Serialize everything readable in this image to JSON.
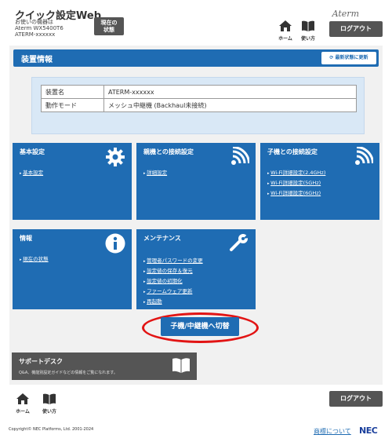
{
  "header": {
    "app_title": "クイック設定Web",
    "device_lines": [
      "お使いの機器は",
      "Aterm WX5400T6",
      "ATERM-xxxxxx"
    ],
    "state_button": "現在の\n状態",
    "logo": "Aterm",
    "home_label": "ホーム",
    "help_label": "使い方",
    "logout_label": "ログアウト"
  },
  "section": {
    "title": "装置情報",
    "refresh_label": "最新状態に更新"
  },
  "device_info": [
    {
      "key": "装置名",
      "value": "ATERM-xxxxxx"
    },
    {
      "key": "動作モード",
      "value": "メッシュ中継機 (Backhaul未接続)"
    }
  ],
  "cards": {
    "basic": {
      "title": "基本設定",
      "icon": "gear-icon",
      "links": [
        "基本設定"
      ]
    },
    "parent": {
      "title": "親機との接続設定",
      "icon": "wifi-icon",
      "links": [
        "詳細設定"
      ]
    },
    "child": {
      "title": "子機との接続設定",
      "icon": "wifi-icon",
      "links": [
        "Wi-Fi詳細設定(2.4GHz)",
        "Wi-Fi詳細設定(5GHz)",
        "Wi-Fi詳細設定(6GHz)"
      ]
    },
    "info": {
      "title": "情報",
      "icon": "info-icon",
      "links": [
        "現在の状態"
      ]
    },
    "maint": {
      "title": "メンテナンス",
      "icon": "wrench-icon",
      "links": [
        "管理者パスワードの変更",
        "設定値の保存＆復元",
        "設定値の初期化",
        "ファームウェア更新",
        "再起動"
      ]
    }
  },
  "switch_button": "子機/中継機へ切替",
  "support": {
    "title": "サポートデスク",
    "desc": "Q&A、機能別設定ガイドなどの情報をご覧になれます。",
    "icon": "book-icon"
  },
  "footer": {
    "home_label": "ホーム",
    "help_label": "使い方",
    "logout_label": "ログアウト",
    "copyright": "Copyright© NEC Platforms, Ltd. 2001-2024",
    "about_link": "商標について",
    "nec_logo": "NEC"
  },
  "colors": {
    "accent": "#1f6cb3",
    "dark_button": "#555555",
    "highlight_ring": "#e21414"
  }
}
